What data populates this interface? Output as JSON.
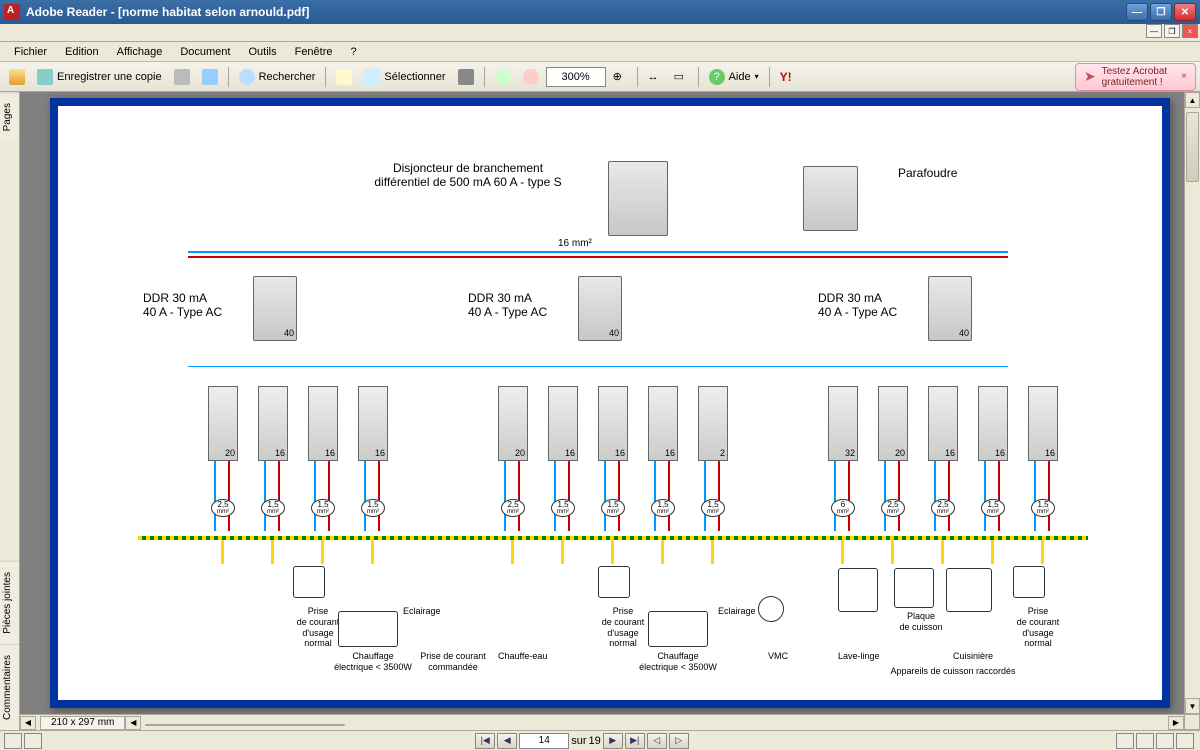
{
  "titlebar": {
    "app_name": "Adobe Reader",
    "doc_name": "[norme habitat selon arnould.pdf]"
  },
  "menubar": {
    "items": [
      "Fichier",
      "Edition",
      "Affichage",
      "Document",
      "Outils",
      "Fenêtre",
      "?"
    ]
  },
  "toolbar": {
    "save_copy": "Enregistrer une copie",
    "search": "Rechercher",
    "select": "Sélectionner",
    "zoom_value": "300%",
    "help": "Aide",
    "promo_line1": "Testez Acrobat",
    "promo_line2": "gratuitement !"
  },
  "side_tabs": [
    "Pages",
    "Pièces jointes",
    "Commentaires"
  ],
  "statusbar": {
    "dimensions": "210 x 297 mm",
    "page_current": "14",
    "page_sep": "sur",
    "page_total": "19"
  },
  "diagram": {
    "top_main": "Disjoncteur de branchement\ndifférentiel de 500 mA 60 A - type S",
    "top_para": "Parafoudre",
    "bus_cable": "16 mm²",
    "ddr": {
      "left": "DDR 30 mA\n40 A - Type AC",
      "center": "DDR 30 mA\n40 A - Type AC",
      "right": "DDR 30 mA\n40 A - Type AC"
    },
    "breaker_ratings": {
      "g1": [
        "20",
        "16",
        "16",
        "16"
      ],
      "g2": [
        "20",
        "16",
        "16",
        "16",
        "2"
      ],
      "g3": [
        "32",
        "20",
        "16",
        "16",
        "16"
      ]
    },
    "wire_sizes": {
      "g1": [
        "2,5",
        "1,5",
        "1,5",
        "1,5"
      ],
      "g2": [
        "2,5",
        "1,5",
        "1,5",
        "1,5",
        "1,5"
      ],
      "g3": [
        "6",
        "2,5",
        "2,5",
        "1,5",
        "1,5"
      ],
      "unit": "mm²"
    },
    "loads": {
      "g1": [
        "",
        "Prise\nde courant\nd'usage\nnormal",
        "Chauffage\nélectrique < 3500W",
        "Eclairage",
        "Prise de courant\ncommandée"
      ],
      "g2": [
        "Chauffe-eau",
        "Prise\nde courant\nd'usage\nnormal",
        "Chauffage\nélectrique < 3500W",
        "Eclairage",
        "VMC"
      ],
      "g3": [
        "Lave-linge",
        "Plaque\nde cuisson",
        "Cuisinière",
        "Prise\nde courant\nd'usage\nnormal",
        "Appareils de cuisson raccordés"
      ]
    },
    "ddr_rating": "40"
  }
}
